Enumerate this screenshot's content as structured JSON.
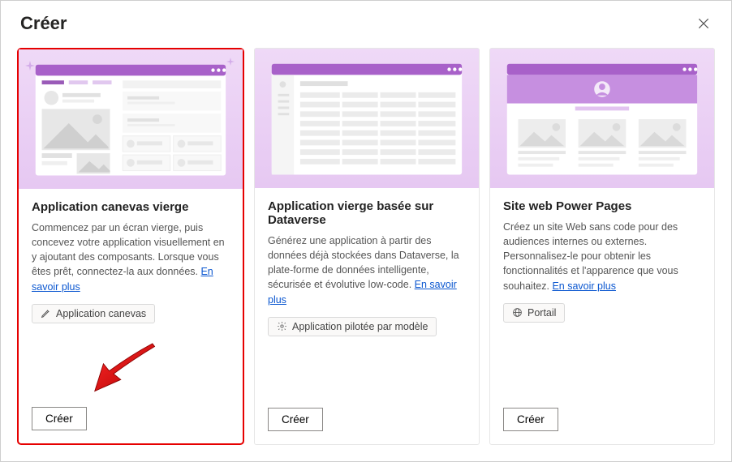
{
  "dialog": {
    "title": "Créer"
  },
  "cards": [
    {
      "title": "Application canevas vierge",
      "desc": "Commencez par un écran vierge, puis concevez votre application visuellement en y ajoutant des composants. Lorsque vous êtes prêt, connectez-la aux données. ",
      "link": "En savoir plus",
      "tag": "Application canevas",
      "cta": "Créer"
    },
    {
      "title": "Application vierge basée sur Dataverse",
      "desc": "Générez une application à partir des données déjà stockées dans Dataverse, la plate-forme de données intelligente, sécurisée et évolutive low-code. ",
      "link": "En savoir plus",
      "tag": "Application pilotée par modèle",
      "cta": "Créer"
    },
    {
      "title": "Site web Power Pages",
      "desc": "Créez un site Web sans code pour des audiences internes ou externes. Personnalisez-le pour obtenir les fonctionnalités et l'apparence que vous souhaitez. ",
      "link": "En savoir plus",
      "tag": "Portail",
      "cta": "Créer"
    }
  ]
}
